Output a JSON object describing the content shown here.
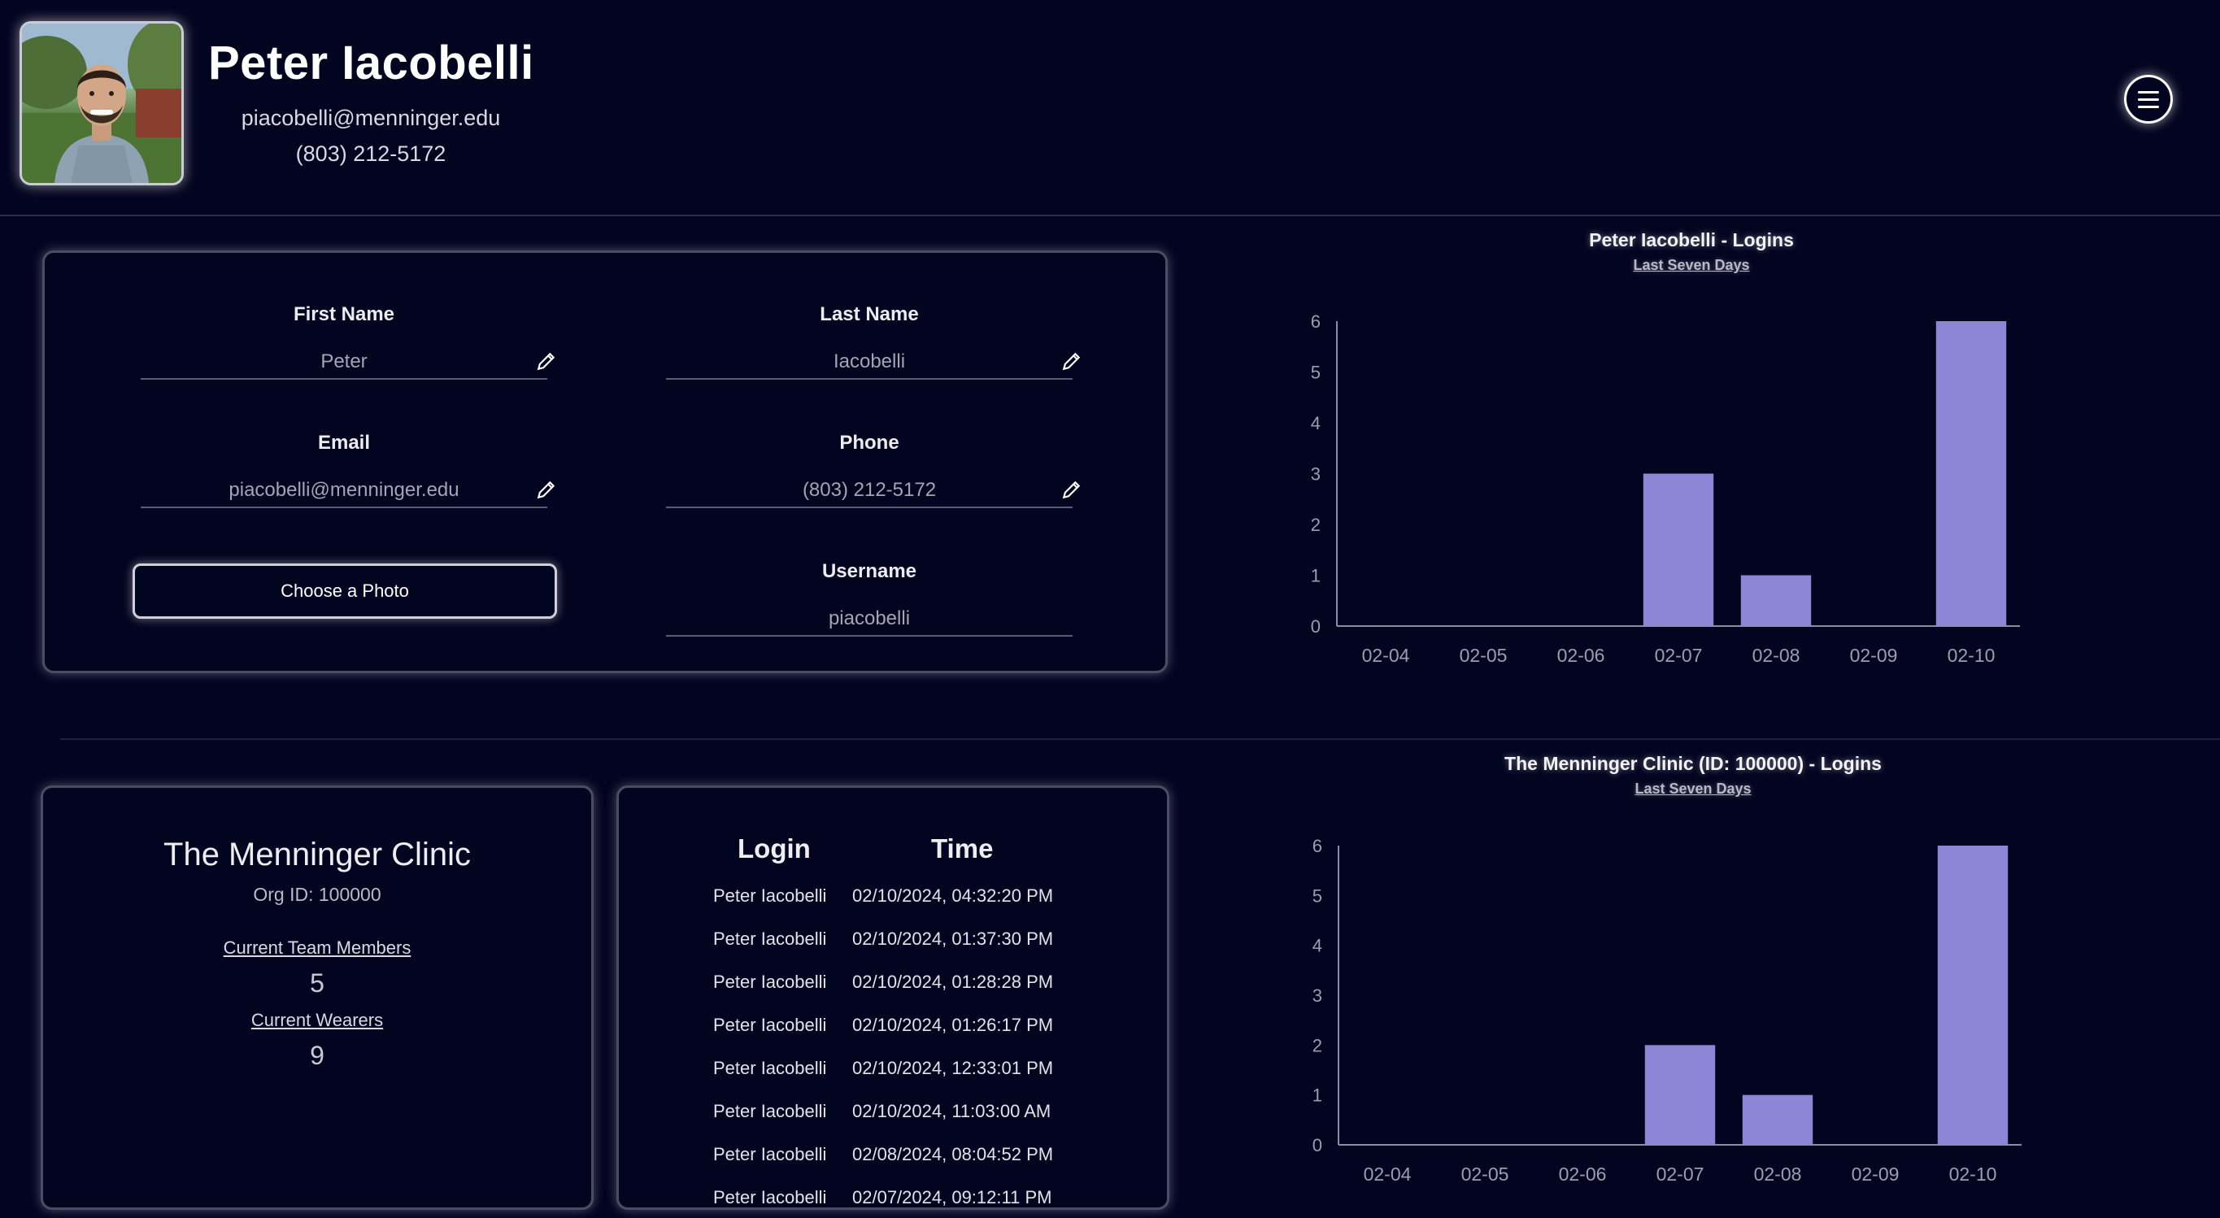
{
  "profile": {
    "name": "Peter Iacobelli",
    "email": "piacobelli@menninger.edu",
    "phone": "(803) 212-5172"
  },
  "form": {
    "first_name_label": "First Name",
    "first_name_value": "Peter",
    "last_name_label": "Last Name",
    "last_name_value": "Iacobelli",
    "email_label": "Email",
    "email_value": "piacobelli@menninger.edu",
    "phone_label": "Phone",
    "phone_value": "(803) 212-5172",
    "username_label": "Username",
    "username_value": "piacobelli",
    "choose_photo_label": "Choose a Photo"
  },
  "org": {
    "name": "The Menninger Clinic",
    "org_id": "Org ID: 100000",
    "team_members_label": "Current Team Members",
    "team_members_count": "5",
    "wearers_label": "Current Wearers",
    "wearers_count": "9"
  },
  "logins_table": {
    "col_login": "Login",
    "col_time": "Time",
    "rows": [
      {
        "who": "Peter Iacobelli",
        "when": "02/10/2024, 04:32:20 PM"
      },
      {
        "who": "Peter Iacobelli",
        "when": "02/10/2024, 01:37:30 PM"
      },
      {
        "who": "Peter Iacobelli",
        "when": "02/10/2024, 01:28:28 PM"
      },
      {
        "who": "Peter Iacobelli",
        "when": "02/10/2024, 01:26:17 PM"
      },
      {
        "who": "Peter Iacobelli",
        "when": "02/10/2024, 12:33:01 PM"
      },
      {
        "who": "Peter Iacobelli",
        "when": "02/10/2024, 11:03:00 AM"
      },
      {
        "who": "Peter Iacobelli",
        "when": "02/08/2024, 08:04:52 PM"
      },
      {
        "who": "Peter Iacobelli",
        "when": "02/07/2024, 09:12:11 PM"
      }
    ]
  },
  "colors": {
    "background": "#03041f",
    "bar": "#8b86d6",
    "axis": "#8a8ca0"
  },
  "chart_data": [
    {
      "type": "bar",
      "title": "Peter Iacobelli - Logins",
      "subtitle": "Last Seven Days",
      "categories": [
        "02-04",
        "02-05",
        "02-06",
        "02-07",
        "02-08",
        "02-09",
        "02-10"
      ],
      "values": [
        0,
        0,
        0,
        3,
        1,
        0,
        6
      ],
      "ylim": [
        0,
        6
      ],
      "yticks": [
        0,
        1,
        2,
        3,
        4,
        5,
        6
      ],
      "grid": false,
      "legend": "none"
    },
    {
      "type": "bar",
      "title": "The Menninger Clinic (ID: 100000) - Logins",
      "subtitle": "Last Seven Days",
      "categories": [
        "02-04",
        "02-05",
        "02-06",
        "02-07",
        "02-08",
        "02-09",
        "02-10"
      ],
      "values": [
        0,
        0,
        0,
        2,
        1,
        0,
        6
      ],
      "ylim": [
        0,
        6
      ],
      "yticks": [
        0,
        1,
        2,
        3,
        4,
        5,
        6
      ],
      "grid": false,
      "legend": "none"
    }
  ]
}
